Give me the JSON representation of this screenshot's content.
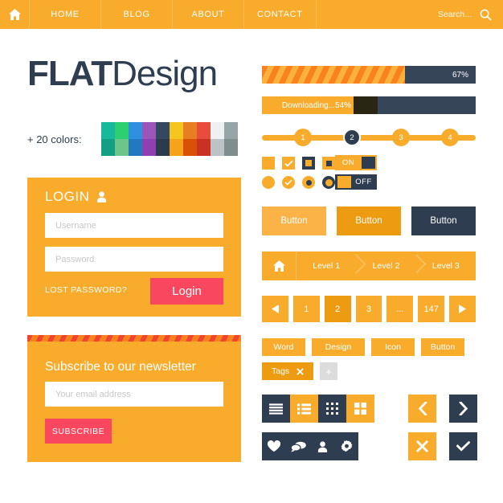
{
  "navbar": {
    "home_icon": "home-icon",
    "items": [
      {
        "label": "HOME"
      },
      {
        "label": "BLOG"
      },
      {
        "label": "ABOUT"
      },
      {
        "label": "CONTACT"
      }
    ],
    "search": {
      "placeholder": "Search...",
      "value": "Search...",
      "icon": "search-icon"
    },
    "bg": "#f9ac2c"
  },
  "logo": {
    "bold": "FLAT",
    "light": "Design",
    "color": "#2e3e50"
  },
  "palette": {
    "label": "+ 20 colors:",
    "columns": [
      {
        "top": "#18b99a",
        "bottom": "#12a085"
      },
      {
        "top": "#2dd070",
        "bottom": "#6dc58a"
      },
      {
        "top": "#2f90df",
        "bottom": "#2379bf"
      },
      {
        "top": "#9c56b9",
        "bottom": "#8f3fb0"
      },
      {
        "top": "#344860",
        "bottom": "#2b3a4c"
      },
      {
        "top": "#f7c520",
        "bottom": "#f5a31b"
      },
      {
        "top": "#e87e22",
        "bottom": "#d95106"
      },
      {
        "top": "#e84c3d",
        "bottom": "#c93122"
      },
      {
        "top": "#eef0f1",
        "bottom": "#bcc3c7"
      },
      {
        "top": "#96a5a6",
        "bottom": "#7f8e8d"
      }
    ]
  },
  "login": {
    "title": "LOGIN",
    "user_icon": "user-icon",
    "username": {
      "placeholder": "Username",
      "value": ""
    },
    "password": {
      "placeholder": "Password",
      "value": ""
    },
    "lost_password": "LOST PASSWORD?",
    "submit": "Login",
    "accent": "#f8475f"
  },
  "newsletter": {
    "title": "Subscribe to our newsletter",
    "email": {
      "placeholder": "Your email address",
      "value": ""
    },
    "submit": "SUBSCRIBE"
  },
  "progress": [
    {
      "id": "striped",
      "percent": 67,
      "label": "67%",
      "style": "striped"
    },
    {
      "id": "download",
      "percent": 54,
      "label": "Downloading...54%",
      "style": "solid"
    }
  ],
  "steps": {
    "items": [
      {
        "label": "1",
        "state": "done"
      },
      {
        "label": "2",
        "state": "active"
      },
      {
        "label": "3",
        "state": "todo"
      },
      {
        "label": "4",
        "state": "todo"
      }
    ]
  },
  "controls": {
    "checkbox_filled": "checkbox-filled-icon",
    "checkbox_check": "checkbox-check-icon",
    "checkbox_ring": "checkbox-ring-icon",
    "checkbox_inner": "checkbox-inner-icon",
    "radio_filled": "radio-filled-icon",
    "radio_check": "radio-check-icon",
    "radio_dot": "radio-dot-icon",
    "radio_ring": "radio-ring-icon",
    "toggle_on_label": "ON",
    "toggle_off_label": "OFF"
  },
  "buttons": [
    {
      "label": "Button",
      "bg": "#fbb347"
    },
    {
      "label": "Button",
      "bg": "#ed9b10"
    },
    {
      "label": "Button",
      "bg": "#2e3e50"
    }
  ],
  "breadcrumb": {
    "home_icon": "home-icon",
    "items": [
      {
        "label": "Level 1"
      },
      {
        "label": "Level 2"
      },
      {
        "label": "Level 3"
      }
    ]
  },
  "pagination": {
    "prev_icon": "triangle-left-icon",
    "next_icon": "triangle-right-icon",
    "pages": [
      "1",
      "2",
      "3",
      "...",
      "147"
    ],
    "active": "2"
  },
  "tags": {
    "row1": [
      {
        "label": "Word"
      },
      {
        "label": "Design"
      },
      {
        "label": "Icon"
      },
      {
        "label": "Button"
      }
    ],
    "row2": {
      "label": "Tags",
      "close_icon": "close-icon",
      "add_label": "+"
    }
  },
  "icon_bar_views": [
    {
      "icon": "list-lines-icon",
      "bg": "dark"
    },
    {
      "icon": "list-bullets-icon",
      "bg": "amber"
    },
    {
      "icon": "grid-dots-icon",
      "bg": "dark"
    },
    {
      "icon": "grid-squares-icon",
      "bg": "amber"
    }
  ],
  "icon_bar_social": [
    {
      "icon": "heart-icon"
    },
    {
      "icon": "chat-icon"
    },
    {
      "icon": "user-icon"
    },
    {
      "icon": "gear-icon"
    }
  ],
  "arrow_buttons": [
    {
      "name": "prev",
      "icon": "chevron-left-icon",
      "bg": "amber"
    },
    {
      "name": "next",
      "icon": "chevron-right-icon",
      "bg": "dark"
    },
    {
      "name": "close",
      "icon": "close-icon",
      "bg": "amber"
    },
    {
      "name": "confirm",
      "icon": "check-icon",
      "bg": "dark"
    }
  ]
}
